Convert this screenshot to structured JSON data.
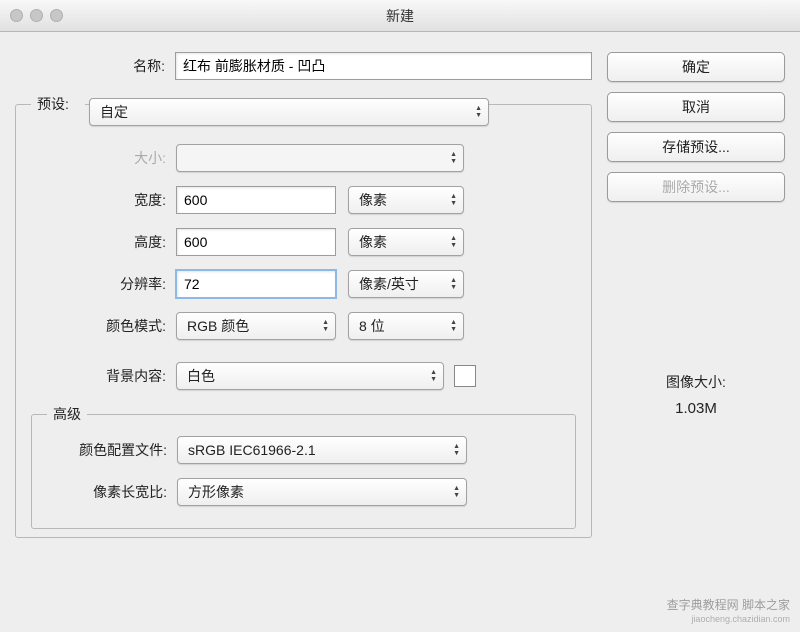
{
  "title": "新建",
  "name_row": {
    "label": "名称:",
    "value": "红布 前膨胀材质 - 凹凸"
  },
  "preset": {
    "legend": "预设:",
    "value": "自定"
  },
  "size": {
    "label": "大小:",
    "value": ""
  },
  "width": {
    "label": "宽度:",
    "value": "600",
    "unit": "像素"
  },
  "height": {
    "label": "高度:",
    "value": "600",
    "unit": "像素"
  },
  "resolution": {
    "label": "分辨率:",
    "value": "72",
    "unit": "像素/英寸"
  },
  "color_mode": {
    "label": "颜色模式:",
    "value": "RGB 颜色",
    "depth": "8 位"
  },
  "background": {
    "label": "背景内容:",
    "value": "白色",
    "swatch_color": "#ffffff"
  },
  "advanced": {
    "legend": "高级",
    "color_profile": {
      "label": "颜色配置文件:",
      "value": "sRGB IEC61966-2.1"
    },
    "aspect": {
      "label": "像素长宽比:",
      "value": "方形像素"
    }
  },
  "buttons": {
    "ok": "确定",
    "cancel": "取消",
    "save_preset": "存储预设...",
    "delete_preset": "删除预设..."
  },
  "image_size": {
    "label": "图像大小:",
    "value": "1.03M"
  },
  "watermark": {
    "line1": "查字典教程网 脚本之家",
    "line2": "jiaocheng.chazidian.com"
  }
}
